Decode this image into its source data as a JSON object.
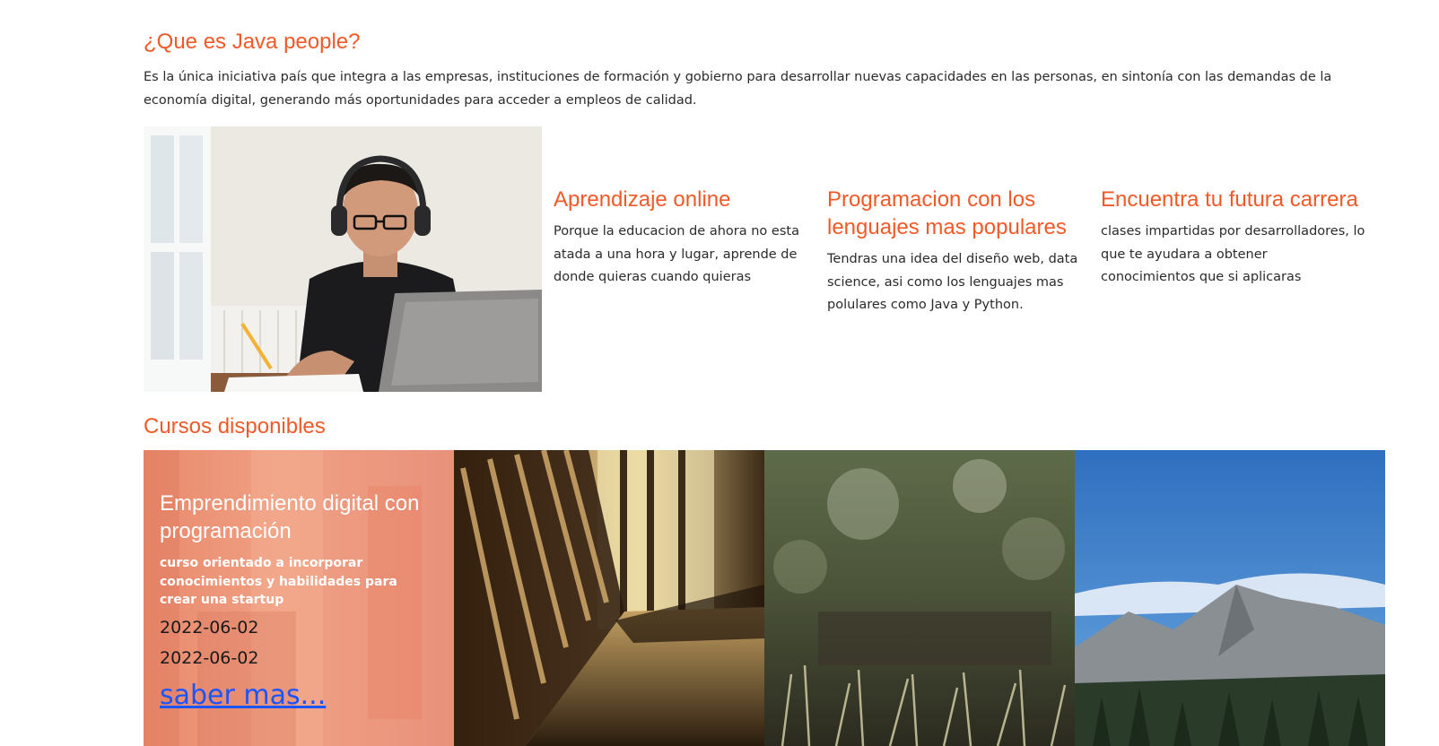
{
  "about": {
    "title": "¿Que es Java people?",
    "text": "Es la única iniciativa país que integra a las empresas, instituciones de formación y gobierno para desarrollar nuevas capacidades en las personas, en sintonía con las demandas de la economía digital, generando más oportunidades para acceder a empleos de calidad."
  },
  "features": [
    {
      "title": "Aprendizaje online",
      "text": "Porque la educacion de ahora no esta atada a una hora y lugar, aprende de donde quieras cuando quieras"
    },
    {
      "title": "Programacion con los lenguajes mas populares",
      "text": "Tendras una idea del diseño web, data science, asi como los lenguajes mas polulares como Java y Python."
    },
    {
      "title": "Encuentra tu futura carrera",
      "text": "clases impartidas por desarrolladores, lo que te ayudara a obtener conocimientos que si aplicaras"
    }
  ],
  "courses": {
    "title": "Cursos disponibles",
    "items": [
      {
        "title": "Emprendimiento digital con programación",
        "description": "curso orientado a incorporar conocimientos y habilidades para crear una startup",
        "start_date": "2022-06-02",
        "end_date": "2022-06-02",
        "link_label": "saber mas..."
      }
    ]
  },
  "colors": {
    "accent": "#f05a28",
    "link": "#1a55ff"
  }
}
